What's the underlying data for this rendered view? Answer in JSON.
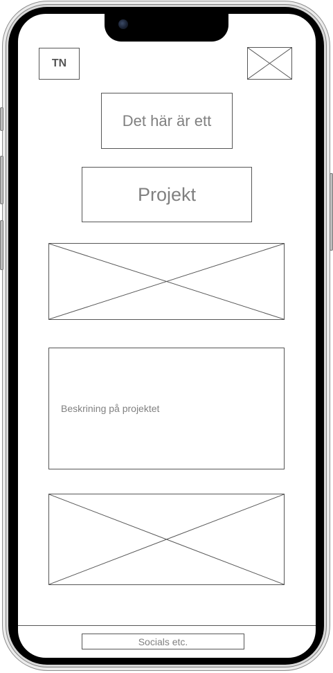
{
  "header": {
    "logo_text": "TN",
    "image_placeholder": "image-placeholder-icon"
  },
  "main": {
    "headline_line1": "Det här är ett",
    "headline_line2": "Projekt",
    "hero_image": "image-placeholder-icon",
    "description": "Beskrining på projektet",
    "bottom_image": "image-placeholder-icon"
  },
  "footer": {
    "socials_label": "Socials etc."
  },
  "colors": {
    "wireframe_stroke": "#555555",
    "text_gray": "#808080",
    "bezel": "#000000"
  }
}
